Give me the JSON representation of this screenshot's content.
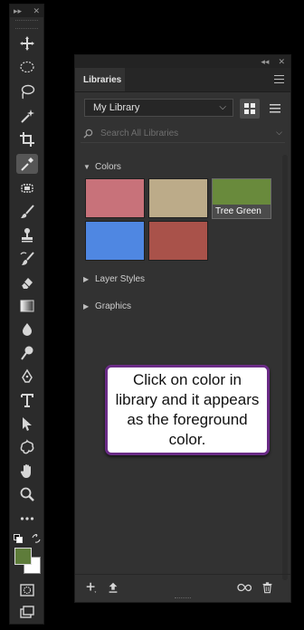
{
  "tools_panel": {
    "tools": [
      {
        "name": "move-tool-icon",
        "active": false
      },
      {
        "name": "marquee-tool-icon",
        "active": false
      },
      {
        "name": "lasso-tool-icon",
        "active": false
      },
      {
        "name": "magic-wand-tool-icon",
        "active": false
      },
      {
        "name": "crop-tool-icon",
        "active": false
      },
      {
        "name": "eyedropper-tool-icon",
        "active": true
      },
      {
        "name": "healing-brush-tool-icon",
        "active": false
      },
      {
        "name": "brush-tool-icon",
        "active": false
      },
      {
        "name": "clone-stamp-tool-icon",
        "active": false
      },
      {
        "name": "history-brush-tool-icon",
        "active": false
      },
      {
        "name": "eraser-tool-icon",
        "active": false
      },
      {
        "name": "gradient-tool-icon",
        "active": false
      },
      {
        "name": "blur-tool-icon",
        "active": false
      },
      {
        "name": "dodge-tool-icon",
        "active": false
      },
      {
        "name": "pen-tool-icon",
        "active": false
      },
      {
        "name": "type-tool-icon",
        "active": false
      },
      {
        "name": "path-selection-tool-icon",
        "active": false
      },
      {
        "name": "custom-shape-tool-icon",
        "active": false
      },
      {
        "name": "hand-tool-icon",
        "active": false
      },
      {
        "name": "zoom-tool-icon",
        "active": false
      },
      {
        "name": "more-tools-icon",
        "active": false
      }
    ],
    "foreground_color": "#5e7c3a",
    "background_color": "#ffffff"
  },
  "libraries_panel": {
    "tab_label": "Libraries",
    "library_select": "My Library",
    "search_placeholder": "Search All Libraries",
    "sections": {
      "colors": "Colors",
      "layer_styles": "Layer Styles",
      "graphics": "Graphics"
    },
    "colors": [
      {
        "hex": "#c8727a",
        "label": ""
      },
      {
        "hex": "#bcab89",
        "label": ""
      },
      {
        "hex": "#698a3c",
        "label": "Tree Green",
        "selected": true
      },
      {
        "hex": "#4f87e2",
        "label": ""
      },
      {
        "hex": "#a9524a",
        "label": ""
      }
    ]
  },
  "callout": {
    "text": "Click on color in library and it appears as the foreground color."
  }
}
